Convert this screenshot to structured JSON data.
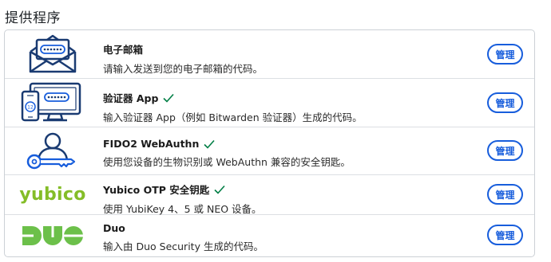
{
  "section_title": "提供程序",
  "providers": [
    {
      "icon": "email-envelope-icon",
      "title": "电子邮箱",
      "verified": false,
      "description": "请输入发送到您的电子邮箱的代码。",
      "button_label": "管理"
    },
    {
      "icon": "authenticator-app-icon",
      "title": "验证器 App",
      "verified": true,
      "description": "输入验证器 App（例如 Bitwarden 验证器）生成的代码。",
      "button_label": "管理"
    },
    {
      "icon": "webauthn-user-key-icon",
      "title": "FIDO2 WebAuthn",
      "verified": true,
      "description": "使用您设备的生物识别或 WebAuthn 兼容的安全钥匙。",
      "button_label": "管理"
    },
    {
      "icon": "yubico-logo",
      "logo_text": "yubico",
      "title": "Yubico OTP 安全钥匙",
      "verified": true,
      "description": "使用 YubiKey 4、5 或 NEO 设备。",
      "button_label": "管理"
    },
    {
      "icon": "duo-logo",
      "title": "Duo",
      "verified": false,
      "description": "输入由 Duo Security 生成的代码。",
      "button_label": "管理"
    }
  ],
  "colors": {
    "primary": "#175ddc",
    "icon_navy": "#1a3b72",
    "check_green": "#017e45",
    "yubico_green": "#84bd28",
    "duo_green": "#6cc04a"
  }
}
